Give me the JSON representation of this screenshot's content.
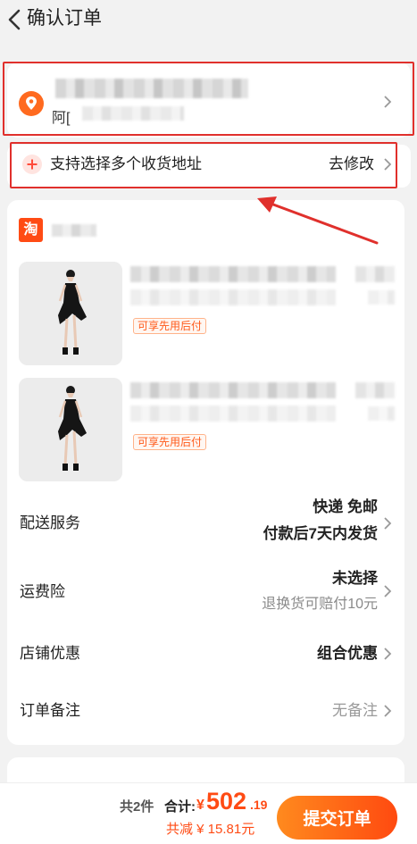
{
  "header": {
    "title": "确认订单"
  },
  "address": {
    "detail_prefix": "阿["
  },
  "multi_address": {
    "label": "支持选择多个收货地址",
    "action": "去修改"
  },
  "shop": {
    "logo_char": "淘"
  },
  "products": [
    {
      "badge": "可享先用后付"
    },
    {
      "badge": "可享先用后付"
    }
  ],
  "delivery": {
    "label": "配送服务",
    "value_line1": "快递 免邮",
    "value_line2": "付款后7天内发货"
  },
  "freight_insurance": {
    "label": "运费险",
    "value": "未选择",
    "sub": "退换货可赔付10元"
  },
  "shop_discount": {
    "label": "店铺优惠",
    "value": "组合优惠"
  },
  "order_note": {
    "label": "订单备注",
    "value": "无备注"
  },
  "footer": {
    "count": "共2件",
    "total_label": "合计:",
    "currency": "¥",
    "total_integer": "502",
    "total_decimal": ".19",
    "discount": "共减 ¥ 15.81元",
    "submit_label": "提交订单"
  },
  "colors": {
    "accent": "#ff4b14",
    "highlight_box": "#e0302c"
  }
}
